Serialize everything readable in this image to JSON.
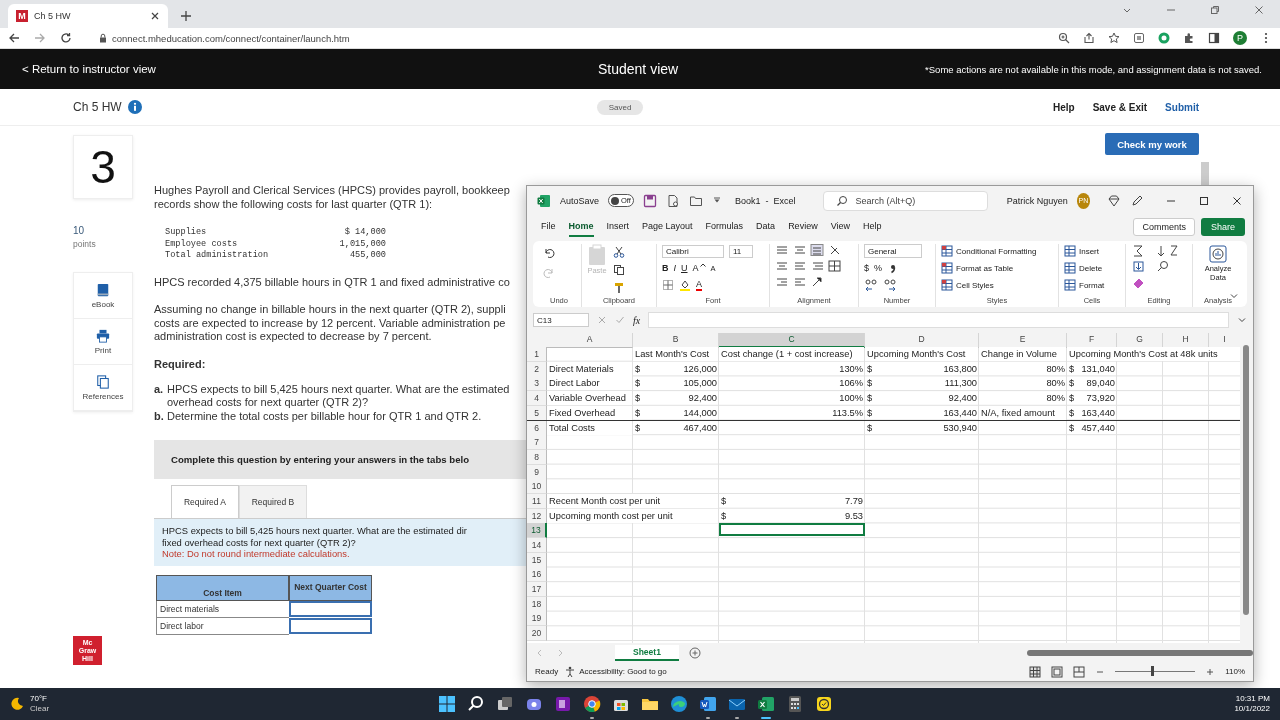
{
  "browser": {
    "tab": {
      "favicon": "M",
      "title": "Ch 5 HW"
    },
    "url": "connect.mheducation.com/connect/container/launch.htm",
    "profile": "P"
  },
  "banner": {
    "back": "< Return to instructor view",
    "title": "Student view",
    "notice": "*Some actions are not available in this mode, and assignment data is not saved."
  },
  "header": {
    "title": "Ch 5 HW",
    "status": "Saved",
    "links": [
      "Help",
      "Save & Exit",
      "Submit"
    ],
    "check_button": "Check my work"
  },
  "question": {
    "number": "3",
    "points": "10",
    "points_label": "points",
    "tools": [
      {
        "kind": "ebook",
        "label": "eBook"
      },
      {
        "kind": "print",
        "label": "Print"
      },
      {
        "kind": "references",
        "label": "References"
      }
    ],
    "intro": [
      "Hughes Payroll and Clerical Services (HPCS) provides payroll, bookkeep",
      "records show the following costs for last quarter (QTR 1):"
    ],
    "costs": [
      {
        "item": "Supplies",
        "amount": "$ 14,000"
      },
      {
        "item": "Employee costs",
        "amount": "1,015,000"
      },
      {
        "item": "Total administration",
        "amount": "455,000"
      }
    ],
    "para1": [
      "HPCS recorded 4,375 billable hours in QTR 1 and fixed administrative co"
    ],
    "para2": [
      "Assuming no change in billable hours in the next quarter (QTR 2), suppli",
      "costs are expected to increase by 12 percent. Variable administration pe",
      "administration cost is expected to decrease by 7 percent."
    ],
    "required_title": "Required:",
    "requirements": [
      {
        "mark": "a.",
        "lines": [
          "HPCS expects to bill 5,425 hours next quarter. What are the estimated",
          "overhead costs for next quarter (QTR 2)?"
        ]
      },
      {
        "mark": "b.",
        "lines": [
          "Determine the total costs per billable hour for QTR 1 and QTR 2."
        ]
      }
    ],
    "instruction": "Complete this question by entering your answers in the tabs belo",
    "tabs": [
      {
        "label": "Required A",
        "selected": true
      },
      {
        "label": "Required B",
        "selected": false
      }
    ],
    "prompt": [
      "HPCS expects to bill 5,425 hours next quarter. What are the estimated dir",
      "fixed overhead costs for next quarter (QTR 2)?"
    ],
    "note": "Note: Do not round intermediate calculations.",
    "answer_table": {
      "columns": [
        "Cost Item",
        "Next Quarter Cost"
      ],
      "rows": [
        "Direct materials",
        "Direct labor"
      ]
    }
  },
  "publisher_logo": [
    "Mc",
    "Graw",
    "Hill"
  ],
  "excel": {
    "autosave_label": "AutoSave",
    "autosave": {
      "label": "Off",
      "on": false
    },
    "title": "Book1  -  Excel",
    "search": "Search (Alt+Q)",
    "user": "Patrick Nguyen",
    "initials": "PN",
    "menu": [
      {
        "label": "File",
        "selected": false
      },
      {
        "label": "Home",
        "selected": true
      },
      {
        "label": "Insert",
        "selected": false
      },
      {
        "label": "Page Layout",
        "selected": false
      },
      {
        "label": "Formulas",
        "selected": false
      },
      {
        "label": "Data",
        "selected": false
      },
      {
        "label": "Review",
        "selected": false
      },
      {
        "label": "View",
        "selected": false
      },
      {
        "label": "Help",
        "selected": false
      }
    ],
    "comments": "Comments",
    "share": "Share",
    "ribbon": [
      {
        "kind": "undo",
        "label": "Undo"
      },
      {
        "kind": "clipboard",
        "label": "Clipboard",
        "paste": {
          "label": "Paste",
          "disabled": true
        }
      },
      {
        "kind": "font",
        "label": "Font",
        "font": "Calibri",
        "size": "11",
        "styles": [
          "B",
          "I",
          "U"
        ],
        "grow": "A",
        "shrink": "A",
        "font_color_label": "A"
      },
      {
        "kind": "alignment",
        "label": "Alignment"
      },
      {
        "kind": "number",
        "label": "Number",
        "format": "General",
        "currency": "$",
        "percent": "%"
      },
      {
        "kind": "styles",
        "label": "Styles",
        "items": [
          "Conditional Formatting",
          "Format as Table",
          "Cell Styles"
        ]
      },
      {
        "kind": "cells",
        "label": "Cells",
        "items": [
          "Insert",
          "Delete",
          "Format"
        ]
      },
      {
        "kind": "editing",
        "label": "Editing"
      },
      {
        "kind": "analysis",
        "label": "Analysis",
        "button": "Analyze Data"
      }
    ],
    "name_box": "C13",
    "fx": "fx",
    "columns": [
      {
        "label": "A",
        "selected": false
      },
      {
        "label": "B",
        "selected": false
      },
      {
        "label": "C",
        "selected": true
      },
      {
        "label": "D",
        "selected": false
      },
      {
        "label": "E",
        "selected": false
      },
      {
        "label": "F",
        "selected": false
      },
      {
        "label": "G",
        "selected": false
      },
      {
        "label": "H",
        "selected": false
      },
      {
        "label": "I",
        "selected": false
      }
    ],
    "rows": [
      {
        "num": "1",
        "selected": false,
        "total": false,
        "cells": {
          "b": {
            "kind": "text",
            "text": "Last Month's Cost"
          },
          "c": {
            "kind": "text",
            "text": "Cost change (1 + cost increase)"
          },
          "d": {
            "kind": "text",
            "text": "Upcoming Month's Cost"
          },
          "e": {
            "kind": "text",
            "text": "Change in Volume"
          },
          "f": {
            "kind": "text",
            "text": "Upcoming Month's Cost at 48k units"
          }
        }
      },
      {
        "num": "2",
        "selected": false,
        "total": false,
        "cells": {
          "a": {
            "kind": "text",
            "text": "Direct Materials"
          },
          "b": {
            "kind": "currency",
            "symbol": "$",
            "text": "126,000"
          },
          "c": {
            "kind": "number",
            "text": "130%"
          },
          "d": {
            "kind": "currency",
            "symbol": "$",
            "text": "163,800"
          },
          "e": {
            "kind": "number",
            "text": "80%"
          },
          "f": {
            "kind": "currency",
            "symbol": "$",
            "text": "131,040"
          }
        }
      },
      {
        "num": "3",
        "selected": false,
        "total": false,
        "cells": {
          "a": {
            "kind": "text",
            "text": "Direct Labor"
          },
          "b": {
            "kind": "currency",
            "symbol": "$",
            "text": "105,000"
          },
          "c": {
            "kind": "number",
            "text": "106%"
          },
          "d": {
            "kind": "currency",
            "symbol": "$",
            "text": "111,300"
          },
          "e": {
            "kind": "number",
            "text": "80%"
          },
          "f": {
            "kind": "currency",
            "symbol": "$",
            "text": "89,040"
          }
        }
      },
      {
        "num": "4",
        "selected": false,
        "total": false,
        "cells": {
          "a": {
            "kind": "text",
            "text": "Variable Overhead"
          },
          "b": {
            "kind": "currency",
            "symbol": "$",
            "text": "92,400"
          },
          "c": {
            "kind": "number",
            "text": "100%"
          },
          "d": {
            "kind": "currency",
            "symbol": "$",
            "text": "92,400"
          },
          "e": {
            "kind": "number",
            "text": "80%"
          },
          "f": {
            "kind": "currency",
            "symbol": "$",
            "text": "73,920"
          }
        }
      },
      {
        "num": "5",
        "selected": false,
        "total": false,
        "cells": {
          "a": {
            "kind": "text",
            "text": "Fixed Overhead"
          },
          "b": {
            "kind": "currency",
            "symbol": "$",
            "text": "144,000"
          },
          "c": {
            "kind": "number",
            "text": "113.5%"
          },
          "d": {
            "kind": "currency",
            "symbol": "$",
            "text": "163,440"
          },
          "e": {
            "kind": "text",
            "text": "N/A, fixed amount"
          },
          "f": {
            "kind": "currency",
            "symbol": "$",
            "text": "163,440"
          }
        }
      },
      {
        "num": "6",
        "selected": false,
        "total": true,
        "cells": {
          "a": {
            "kind": "text",
            "text": "Total Costs"
          },
          "b": {
            "kind": "currency",
            "symbol": "$",
            "text": "467,400"
          },
          "d": {
            "kind": "currency",
            "symbol": "$",
            "text": "530,940"
          },
          "f": {
            "kind": "currency",
            "symbol": "$",
            "text": "457,440"
          }
        }
      },
      {
        "num": "7",
        "selected": false,
        "total": false
      },
      {
        "num": "8",
        "selected": false,
        "total": false
      },
      {
        "num": "9",
        "selected": false,
        "total": false
      },
      {
        "num": "10",
        "selected": false,
        "total": false
      },
      {
        "num": "11",
        "selected": false,
        "total": false,
        "cells": {
          "a": {
            "kind": "text",
            "text": "Recent Month cost per unit"
          },
          "c": {
            "kind": "currency",
            "symbol": "$",
            "text": "7.79"
          }
        }
      },
      {
        "num": "12",
        "selected": false,
        "total": false,
        "cells": {
          "a": {
            "kind": "text",
            "text": "Upcoming month cost per unit"
          },
          "c": {
            "kind": "currency",
            "symbol": "$",
            "text": "9.53"
          }
        }
      },
      {
        "num": "13",
        "selected": true,
        "total": false,
        "cells": {
          "c": {
            "selected": true
          }
        }
      },
      {
        "num": "14",
        "selected": false,
        "total": false
      },
      {
        "num": "15",
        "selected": false,
        "total": false
      },
      {
        "num": "16",
        "selected": false,
        "total": false
      },
      {
        "num": "17",
        "selected": false,
        "total": false
      },
      {
        "num": "18",
        "selected": false,
        "total": false
      },
      {
        "num": "19",
        "selected": false,
        "total": false
      },
      {
        "num": "20",
        "selected": false,
        "total": false
      }
    ],
    "sheet_tabs": [
      {
        "label": "Sheet1",
        "selected": true
      }
    ],
    "status": "Ready",
    "accessibility": "Accessibility: Good to go",
    "zoom": "110%",
    "zoom_slider": {
      "level": 0.45
    }
  },
  "taskbar": {
    "weather": {
      "temp": "70°F",
      "condition": "Clear"
    },
    "apps": [
      {
        "kind": "start",
        "running": false,
        "selected": false
      },
      {
        "kind": "search",
        "running": false,
        "selected": false
      },
      {
        "kind": "taskview",
        "running": false,
        "selected": false
      },
      {
        "kind": "teams",
        "running": false,
        "selected": false
      },
      {
        "kind": "onenote",
        "running": false,
        "selected": false
      },
      {
        "kind": "chrome",
        "running": true,
        "selected": false
      },
      {
        "kind": "store",
        "running": false,
        "selected": false
      },
      {
        "kind": "explorer",
        "running": false,
        "selected": false
      },
      {
        "kind": "edge",
        "running": false,
        "selected": false
      },
      {
        "kind": "word",
        "running": true,
        "selected": false
      },
      {
        "kind": "mail",
        "running": true,
        "selected": false
      },
      {
        "kind": "excel",
        "running": true,
        "selected": true
      },
      {
        "kind": "calculator",
        "running": false,
        "selected": false
      },
      {
        "kind": "notes",
        "running": false,
        "selected": false
      }
    ],
    "time": "10:31 PM",
    "date": "10/1/2022"
  }
}
